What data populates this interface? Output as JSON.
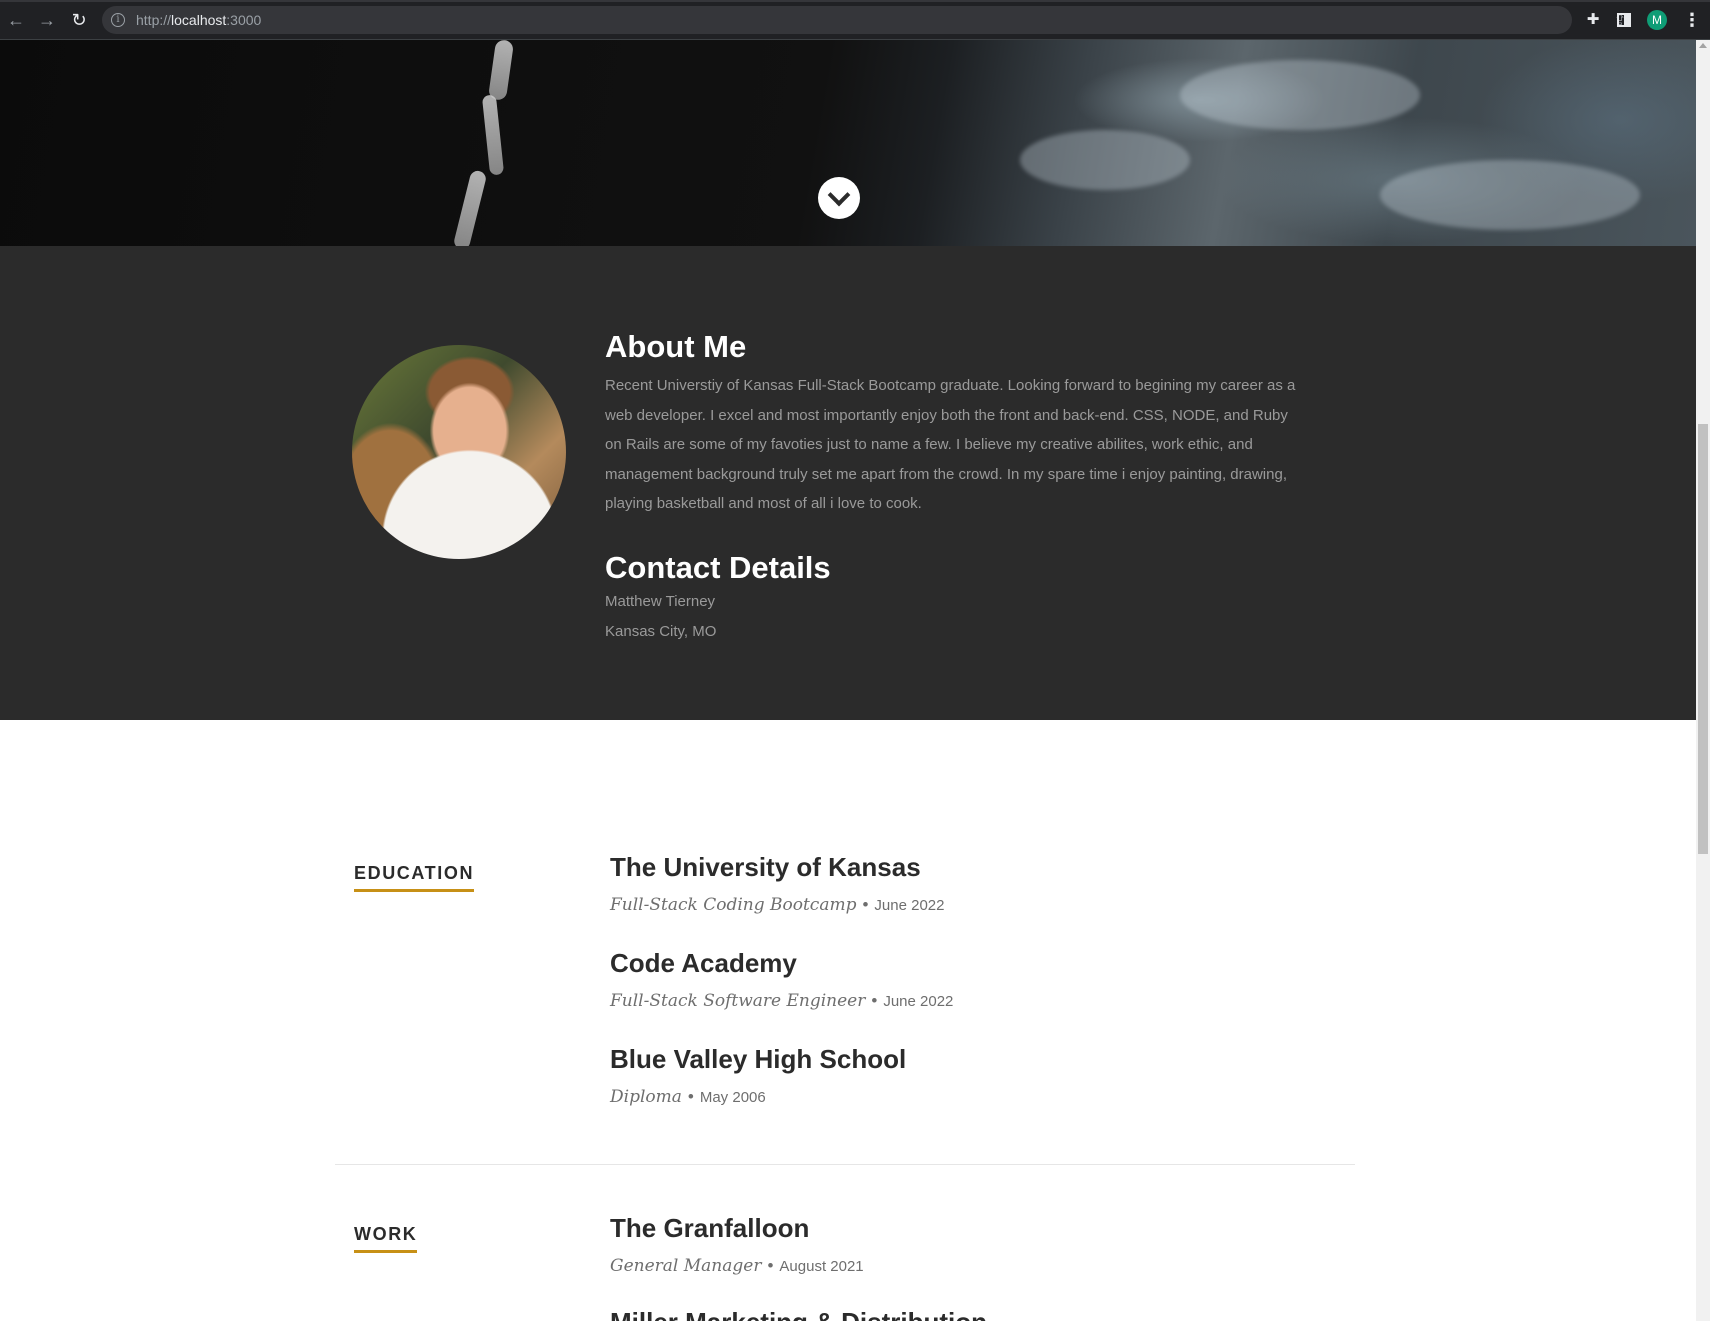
{
  "browser": {
    "url_prefix": "http://",
    "url_host": "localhost",
    "url_port": ":3000",
    "profile_initial": "M"
  },
  "about": {
    "title": "About Me",
    "text": "Recent Universtiy of Kansas Full-Stack Bootcamp graduate. Looking forward to begining my career as a web developer. I excel and most importantly enjoy both the front and back-end. CSS, NODE, and Ruby on Rails are some of my favoties just to name a few. I believe my creative abilites, work ethic, and management background truly set me apart from the crowd. In my spare time i enjoy painting, drawing, playing basketball and most of all i love to cook.",
    "contact_title": "Contact Details",
    "contact_name": "Matthew Tierney",
    "contact_location": "Kansas City, MO"
  },
  "education": {
    "label": "EDUCATION",
    "entries": [
      {
        "title": "The University of Kansas",
        "role": "Full-Stack Coding Bootcamp",
        "bullet": "•",
        "date": "June 2022"
      },
      {
        "title": "Code Academy",
        "role": "Full-Stack Software Engineer",
        "bullet": "•",
        "date": "June 2022"
      },
      {
        "title": "Blue Valley High School",
        "role": "Diploma",
        "bullet": "•",
        "date": "May 2006"
      }
    ]
  },
  "work": {
    "label": "WORK",
    "entries": [
      {
        "title": "The Granfalloon",
        "role": "General Manager",
        "bullet": "•",
        "date": "August 2021"
      },
      {
        "title": "Miller Marketing & Distribution"
      }
    ]
  },
  "colors": {
    "accent": "#c79016",
    "about_bg": "#2b2b2b",
    "heading_dark": "#2b2b2b"
  }
}
